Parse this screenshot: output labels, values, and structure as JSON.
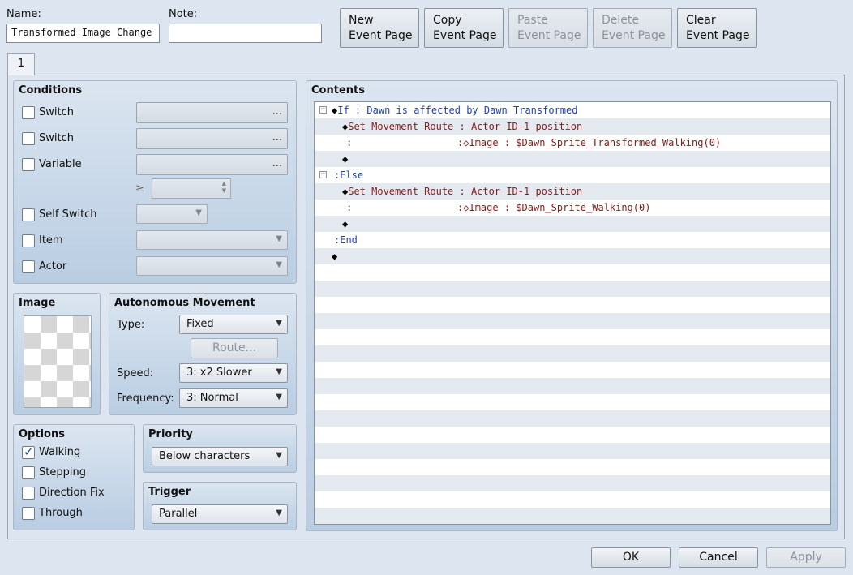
{
  "header": {
    "name_label": "Name:",
    "name_value": "Transformed Image Change",
    "note_label": "Note:",
    "note_value": ""
  },
  "page_buttons": [
    {
      "line1": "New",
      "line2": "Event Page"
    },
    {
      "line1": "Copy",
      "line2": "Event Page"
    },
    {
      "line1": "Paste",
      "line2": "Event Page"
    },
    {
      "line1": "Delete",
      "line2": "Event Page"
    },
    {
      "line1": "Clear",
      "line2": "Event Page"
    }
  ],
  "tab": {
    "label": "1"
  },
  "conditions": {
    "title": "Conditions",
    "switch1": "Switch",
    "switch2": "Switch",
    "variable": "Variable",
    "ge_symbol": "≥",
    "self_switch": "Self Switch",
    "item": "Item",
    "actor": "Actor",
    "dots": "..."
  },
  "image": {
    "title": "Image"
  },
  "autonomous": {
    "title": "Autonomous Movement",
    "type_label": "Type:",
    "type_value": "Fixed",
    "route_button": "Route...",
    "speed_label": "Speed:",
    "speed_value": "3: x2 Slower",
    "frequency_label": "Frequency:",
    "frequency_value": "3: Normal"
  },
  "options": {
    "title": "Options",
    "walking": "Walking",
    "walking_checked": true,
    "stepping": "Stepping",
    "direction_fix": "Direction Fix",
    "through": "Through"
  },
  "priority": {
    "title": "Priority",
    "value": "Below characters"
  },
  "trigger": {
    "title": "Trigger",
    "value": "Parallel"
  },
  "contents": {
    "title": "Contents",
    "lines": {
      "l1_kw": "If",
      "l1_sep": ":",
      "l1_text": "Dawn is affected by Dawn Transformed",
      "l2_cmd": "Set Movement Route",
      "l2_sep": ":",
      "l2_text": "Actor ID-1 position",
      "l3_colon": ":",
      "l3_image": "Image",
      "l3_sep": ":",
      "l3_text": "$Dawn_Sprite_Transformed_Walking(0)",
      "l5_kw": "Else",
      "l6_cmd": "Set Movement Route",
      "l6_text": "Actor ID-1 position",
      "l7_text": "$Dawn_Sprite_Walking(0)",
      "l9_kw": "End"
    }
  },
  "footer": {
    "ok": "OK",
    "cancel": "Cancel",
    "apply": "Apply"
  }
}
